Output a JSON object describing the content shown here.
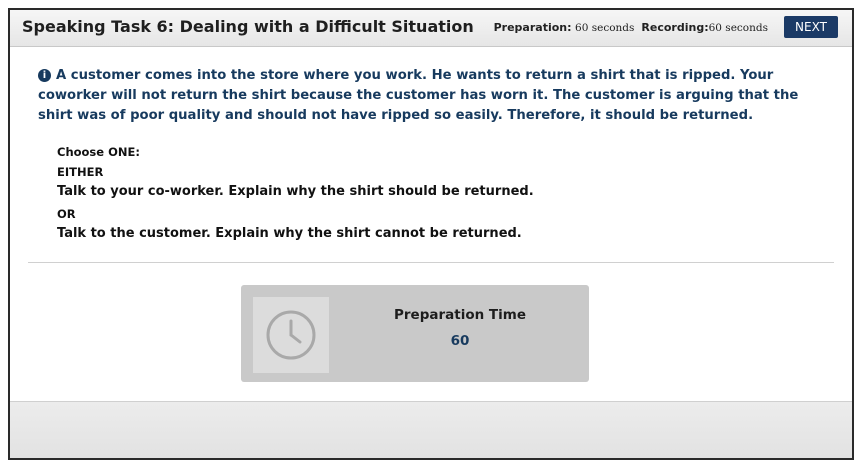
{
  "header": {
    "title": "Speaking Task 6: Dealing with a Difficult Situation",
    "preparation_label": "Preparation:",
    "preparation_value": "60 seconds",
    "recording_label": "Recording:",
    "recording_value": "60 seconds",
    "next_label": "NEXT",
    "next_color": "#1b3a66"
  },
  "prompt": {
    "icon": "info-icon",
    "text": "A customer comes into the store where you work. He wants to return a shirt that is ripped. Your coworker will not return the shirt because the customer has worn it. The customer is arguing that the shirt was of poor quality and should not have ripped so easily. Therefore, it should be returned.",
    "color": "#173a5e"
  },
  "choices": {
    "choose": "Choose ONE:",
    "either": "EITHER",
    "option1": "Talk to your co-worker.  Explain why the shirt should be returned.",
    "or": "OR",
    "option2": "Talk to the customer.  Explain why the shirt cannot be returned."
  },
  "preparation_panel": {
    "icon": "clock-icon",
    "label": "Preparation Time",
    "seconds": "60"
  }
}
